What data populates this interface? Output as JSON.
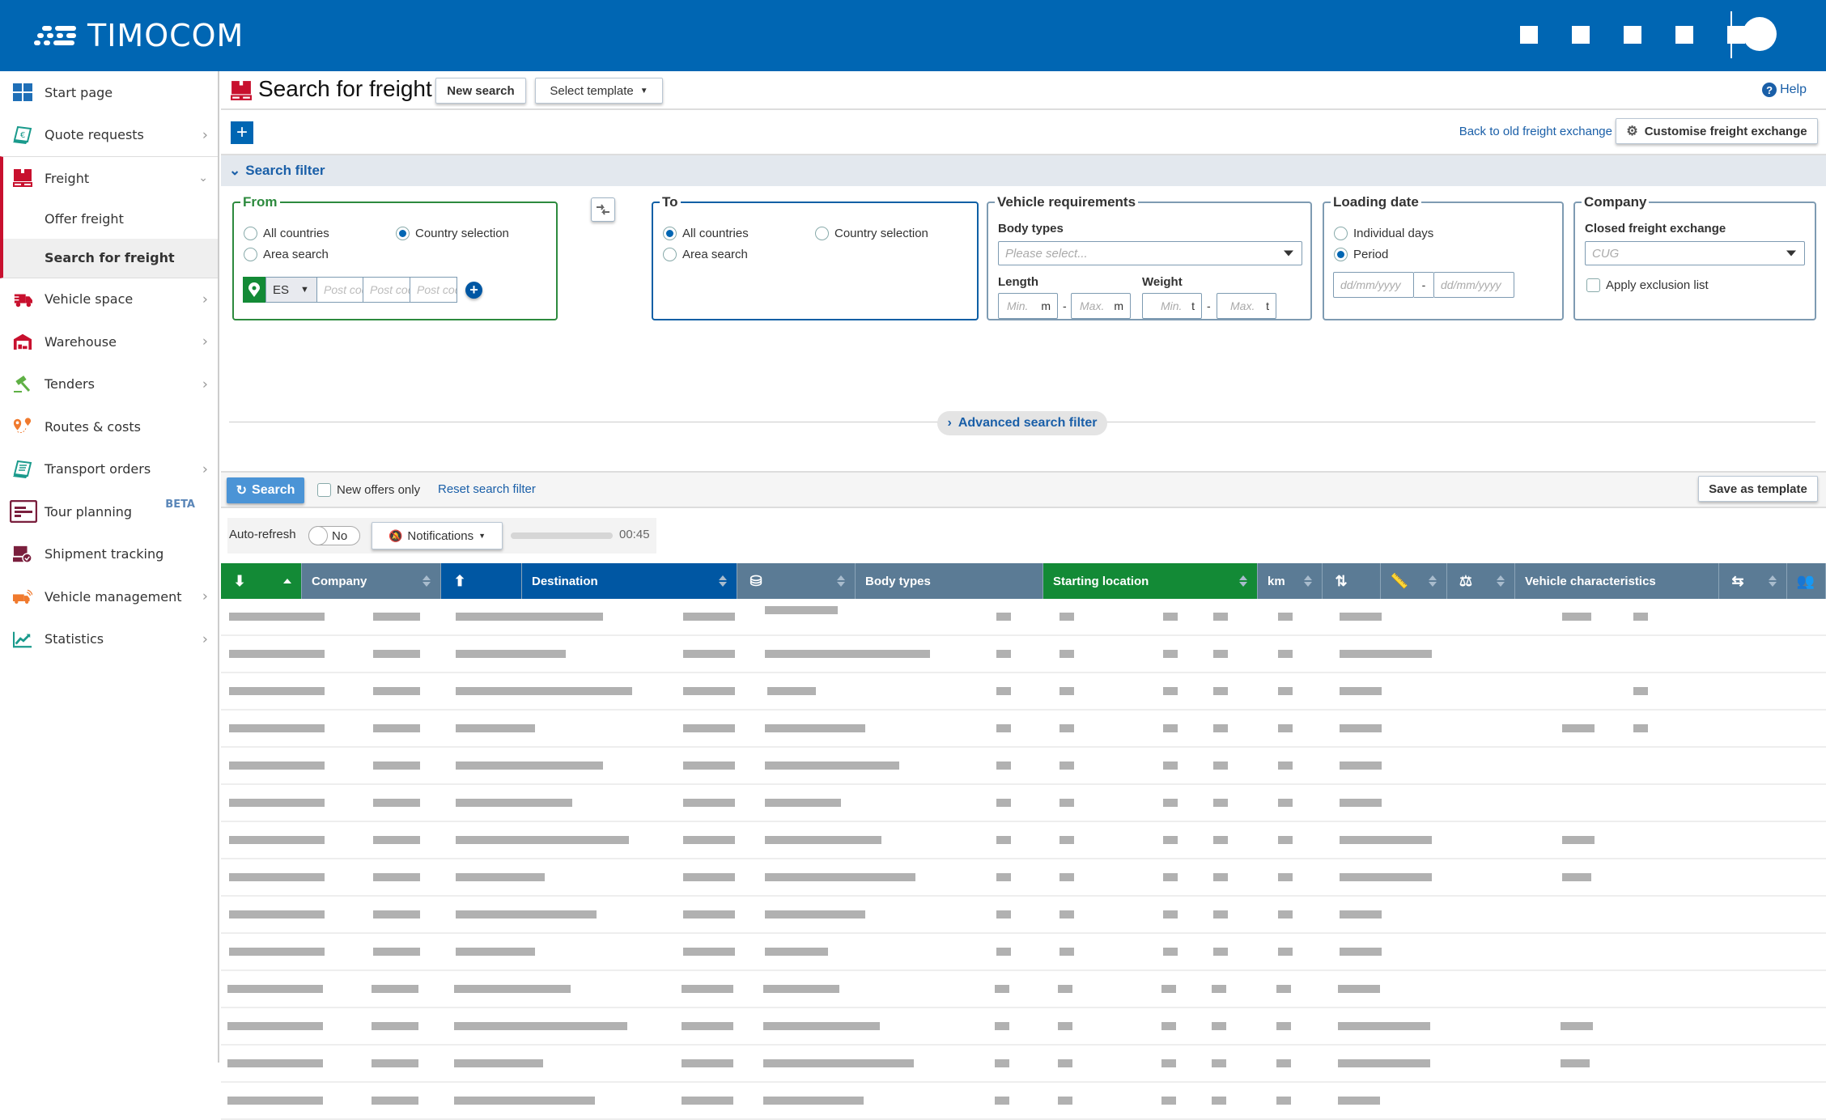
{
  "app": {
    "brand": "TIMOCOM",
    "colors": {
      "brand_blue": "#0066b3",
      "accent_red": "#c8102e",
      "from_green": "#138a36",
      "link_blue": "#1a5fa8"
    }
  },
  "topbar": {
    "icons": [
      "app-icon-1",
      "app-icon-2",
      "app-icon-3",
      "app-icon-4",
      "app-icon-5"
    ],
    "avatar": "user-avatar"
  },
  "sidebar": {
    "items": [
      {
        "label": "Start page",
        "icon": "grid-icon",
        "chevron": false
      },
      {
        "label": "Quote requests",
        "icon": "quote-euro-icon",
        "chevron": true
      },
      {
        "label": "Freight",
        "icon": "freight-icon",
        "chevron": true,
        "expanded": true,
        "children": [
          {
            "label": "Offer freight",
            "active": false
          },
          {
            "label": "Search for freight",
            "active": true
          }
        ]
      },
      {
        "label": "Vehicle space",
        "icon": "truck-icon",
        "chevron": true
      },
      {
        "label": "Warehouse",
        "icon": "warehouse-icon",
        "chevron": true
      },
      {
        "label": "Tenders",
        "icon": "gavel-icon",
        "chevron": true
      },
      {
        "label": "Routes & costs",
        "icon": "route-pins-icon",
        "chevron": false
      },
      {
        "label": "Transport orders",
        "icon": "document-icon",
        "chevron": true
      },
      {
        "label": "Tour planning",
        "icon": "tour-planning-icon",
        "chevron": false,
        "badge": "BETA"
      },
      {
        "label": "Shipment tracking",
        "icon": "shipment-tracking-icon",
        "chevron": false
      },
      {
        "label": "Vehicle management",
        "icon": "vehicle-signal-icon",
        "chevron": true
      },
      {
        "label": "Statistics",
        "icon": "chart-icon",
        "chevron": true
      }
    ]
  },
  "page": {
    "title": "Search for freight",
    "new_search": "New search",
    "select_template": "Select template",
    "help": "Help",
    "back_link": "Back to old freight exchange",
    "customise": "Customise freight exchange",
    "filter_title": "Search filter"
  },
  "filter": {
    "from": {
      "legend": "From",
      "options": [
        "All countries",
        "Country selection",
        "Area search"
      ],
      "selected": "Country selection",
      "country": "ES",
      "postcode_placeholder": "Post code"
    },
    "to": {
      "legend": "To",
      "options": [
        "All countries",
        "Country selection",
        "Area search"
      ],
      "selected": "All countries"
    },
    "vehicle": {
      "legend": "Vehicle requirements",
      "body_types_label": "Body types",
      "body_types_placeholder": "Please select...",
      "length_label": "Length",
      "weight_label": "Weight",
      "min": "Min.",
      "max": "Max.",
      "length_unit": "m",
      "weight_unit": "t",
      "dash": "-"
    },
    "loading": {
      "legend": "Loading date",
      "options": [
        "Individual days",
        "Period"
      ],
      "selected": "Period",
      "date_placeholder": "dd/mm/yyyy",
      "dash": "-"
    },
    "company": {
      "legend": "Company",
      "closed_label": "Closed freight exchange",
      "closed_placeholder": "CUG",
      "exclusion": "Apply exclusion list",
      "exclusion_checked": false
    },
    "advanced": "Advanced search filter"
  },
  "actions": {
    "search": "Search",
    "new_offers_only": "New offers only",
    "new_offers_checked": false,
    "reset": "Reset search filter",
    "save_template": "Save as template"
  },
  "refresh": {
    "label": "Auto-refresh",
    "toggle": "No",
    "notifications": "Notifications",
    "progress": 0.0,
    "timer": "00:45"
  },
  "table": {
    "columns": [
      {
        "label": "",
        "icon": "loading-date-icon",
        "style": "green",
        "sort": "asc"
      },
      {
        "label": "Company",
        "style": "grey",
        "sort": "both"
      },
      {
        "label": "",
        "icon": "unloading-date-icon",
        "style": "blue",
        "sort": "none"
      },
      {
        "label": "Destination",
        "style": "blue",
        "sort": "both"
      },
      {
        "label": "",
        "icon": "coins-icon",
        "style": "grey",
        "sort": "both"
      },
      {
        "label": "Body types",
        "style": "grey",
        "sort": "none"
      },
      {
        "label": "Starting location",
        "style": "green",
        "sort": "both"
      },
      {
        "label": "km",
        "style": "grey",
        "sort": "both"
      },
      {
        "label": "",
        "icon": "load-unload-arrows-icon",
        "style": "grey",
        "sort": "none"
      },
      {
        "label": "",
        "icon": "length-ruler-icon",
        "style": "grey",
        "sort": "both"
      },
      {
        "label": "",
        "icon": "weight-icon",
        "style": "grey",
        "sort": "both"
      },
      {
        "label": "Vehicle characteristics",
        "style": "grey",
        "sort": "none"
      },
      {
        "label": "",
        "icon": "exchange-pallets-icon",
        "style": "grey",
        "sort": "both"
      },
      {
        "label": "",
        "icon": "group-icon",
        "style": "grey",
        "sort": "none"
      }
    ],
    "row_count": 14,
    "rows_note": "Rows are rendered as grey redacted placeholders"
  }
}
